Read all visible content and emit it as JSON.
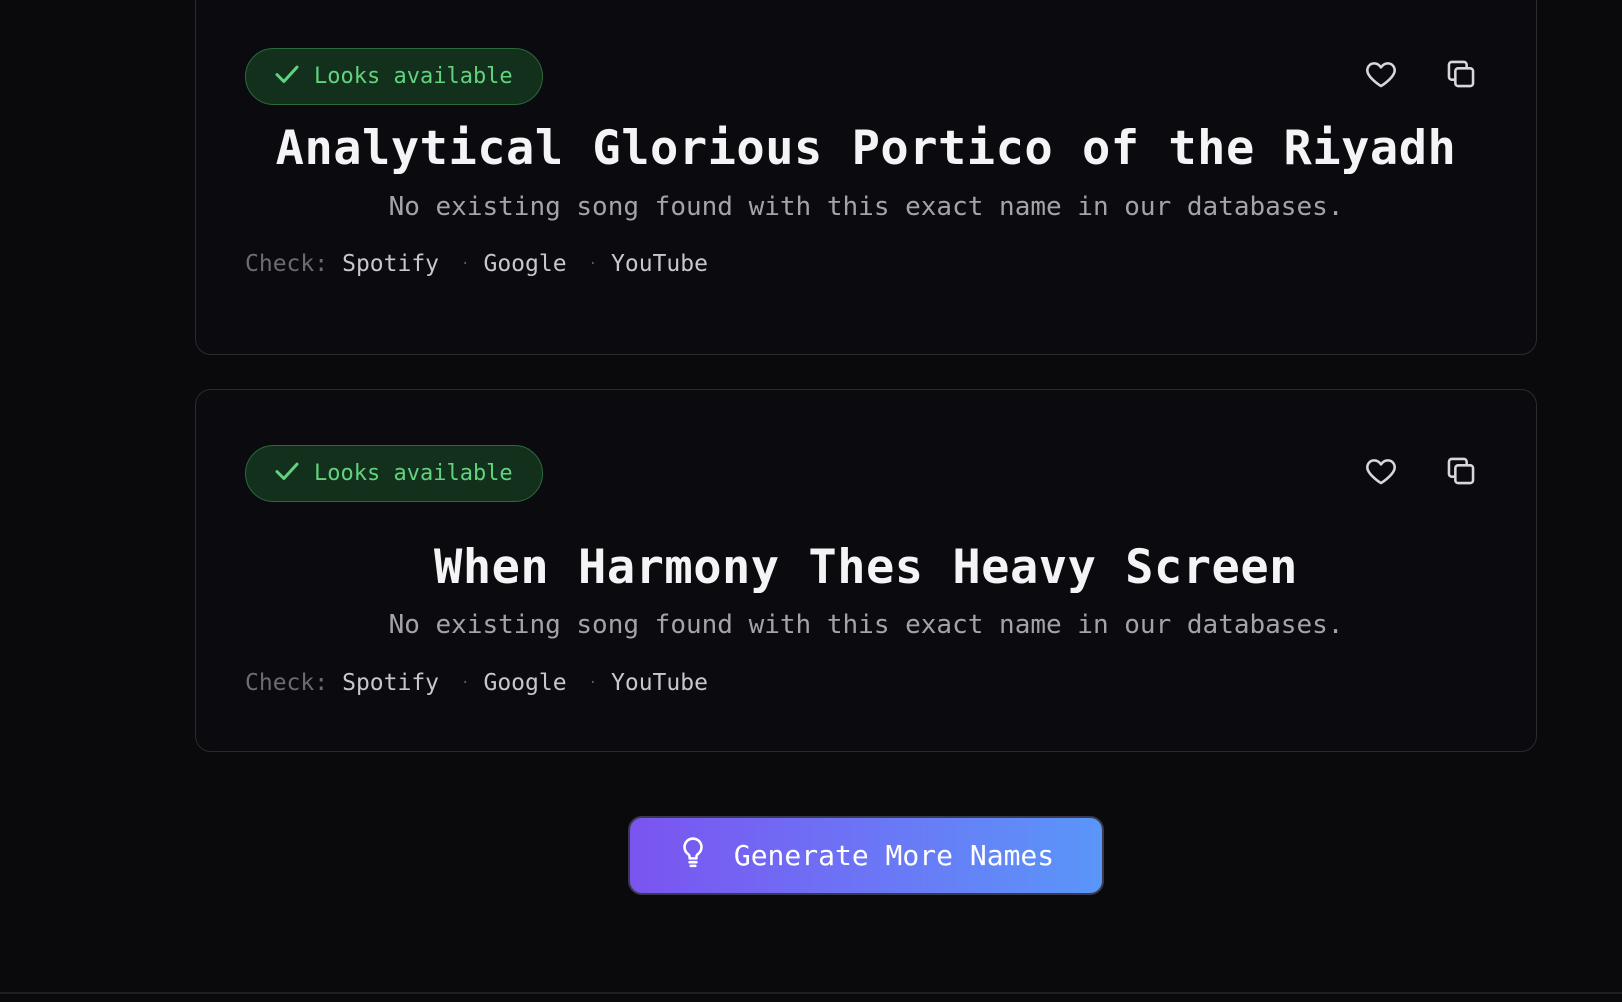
{
  "cards": [
    {
      "badge": "Looks available",
      "title": "Analytical Glorious Portico of the Riyadh",
      "description": "No existing song found with this exact name in our databases.",
      "check_label": "Check:",
      "links": [
        "Spotify",
        "Google",
        "YouTube"
      ]
    },
    {
      "badge": "Looks available",
      "title": "When Harmony Thes Heavy Screen",
      "description": "No existing song found with this exact name in our databases.",
      "check_label": "Check:",
      "links": [
        "Spotify",
        "Google",
        "YouTube"
      ]
    }
  ],
  "generate_button": {
    "label": "Generate More Names",
    "icon": "lightbulb-icon"
  },
  "icons": {
    "badge": "check-icon",
    "favorite": "heart-icon",
    "copy": "copy-icon"
  },
  "colors": {
    "background": "#0a0a0d",
    "badge_text": "#62d27e",
    "badge_bg": "#13301c",
    "button_gradient_start": "#7b54f0",
    "button_gradient_end": "#5a96f8"
  }
}
